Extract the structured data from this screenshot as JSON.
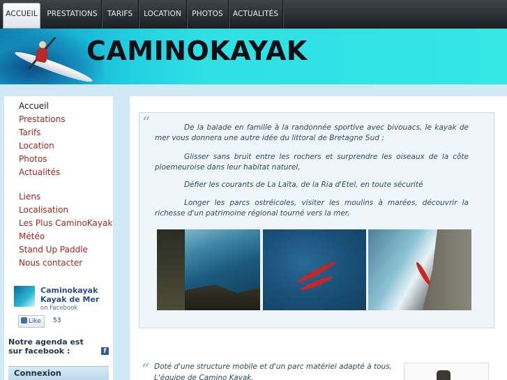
{
  "nav": {
    "tabs": [
      {
        "label": "ACCUEIL"
      },
      {
        "label": "PRESTATIONS"
      },
      {
        "label": "TARIFS"
      },
      {
        "label": "LOCATION"
      },
      {
        "label": "PHOTOS"
      },
      {
        "label": "ACTUALITÉS"
      }
    ]
  },
  "banner": {
    "logo": "CAMINOKAYAK"
  },
  "sidebar": {
    "menu": [
      {
        "label": "Accueil"
      },
      {
        "label": "Prestations"
      },
      {
        "label": "Tarifs"
      },
      {
        "label": "Location"
      },
      {
        "label": "Photos"
      },
      {
        "label": "Actualités"
      }
    ],
    "links": [
      {
        "label": "Liens"
      },
      {
        "label": "Localisation"
      },
      {
        "label": "Les Plus CaminoKayak"
      },
      {
        "label": "Météo"
      },
      {
        "label": "Stand Up Paddle"
      },
      {
        "label": "Nous contacter"
      }
    ],
    "facebook": {
      "name_line1": "Caminokayak",
      "name_line2": "Kayak de Mer",
      "on": "on Facebook",
      "like_label": "Like",
      "like_count": "53"
    },
    "agenda": "Notre agenda est sur facebook :",
    "connexion": "Connexion"
  },
  "main": {
    "quote_mark": "“",
    "paragraphs": [
      "De la balade en famille à la randonnée sportive avec bivouacs, le kayak de mer vous donnera une autre idée du littoral de Bretagne Sud :",
      "Glisser sans bruit entre les rochers et surprendre les oiseaux de la côte ploemeuroise dans leur habitat naturel,",
      "Défier les courants de La Laïta, de la Ria d'Etel, en toute sécurité",
      "Longer les parcs ostréicoles, visiter les moulins à marées, découvrir la richesse d'un patrimoine régional tourné vers la mer,"
    ],
    "second_quote": {
      "line1": "Doté d'une structure mobile et d'un parc matériel adapté à tous,",
      "line2": "L'équipe de Camino Kayak,"
    }
  },
  "colors": {
    "link": "#b8201b",
    "banner": "#2ee0e4",
    "nav": "#2b3034"
  }
}
